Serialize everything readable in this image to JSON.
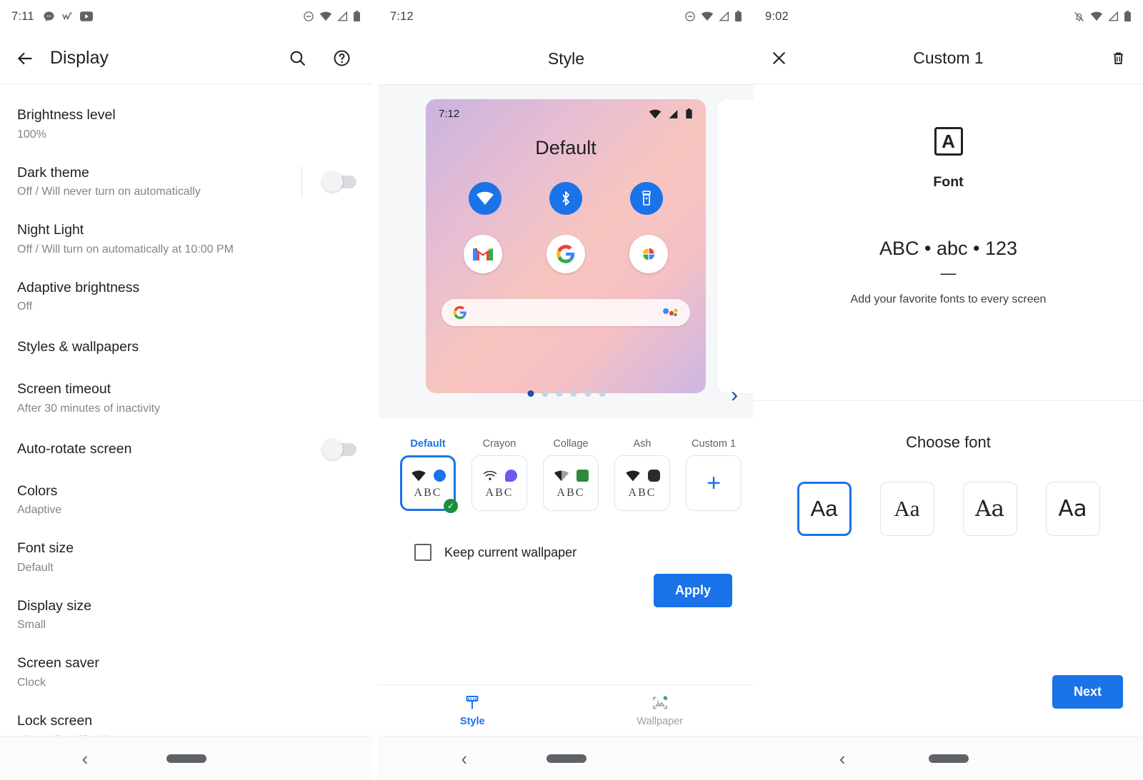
{
  "panel_display": {
    "statusbar": {
      "time": "7:11",
      "notif_icons": [
        "chat-icon",
        "wish-icon",
        "youtube-icon"
      ],
      "right_icons": [
        "dnd-icon",
        "wifi-icon",
        "cellular-icon",
        "battery-icon"
      ]
    },
    "appbar": {
      "title": "Display",
      "back_icon": "arrow-back-icon",
      "search_icon": "search-icon",
      "help_icon": "help-icon"
    },
    "items": [
      {
        "title": "Brightness level",
        "sub": "100%",
        "toggle": null
      },
      {
        "title": "Dark theme",
        "sub": "Off / Will never turn on automatically",
        "toggle": "off"
      },
      {
        "title": "Night Light",
        "sub": "Off / Will turn on automatically at 10:00 PM",
        "toggle": null
      },
      {
        "title": "Adaptive brightness",
        "sub": "Off",
        "toggle": null
      },
      {
        "title": "Styles & wallpapers",
        "sub": "",
        "toggle": null
      },
      {
        "title": "Screen timeout",
        "sub": "After 30 minutes of inactivity",
        "toggle": null
      },
      {
        "title": "Auto-rotate screen",
        "sub": "",
        "toggle": "off"
      },
      {
        "title": "Colors",
        "sub": "Adaptive",
        "toggle": null
      },
      {
        "title": "Font size",
        "sub": "Default",
        "toggle": null
      },
      {
        "title": "Display size",
        "sub": "Small",
        "toggle": null
      },
      {
        "title": "Screen saver",
        "sub": "Clock",
        "toggle": null
      },
      {
        "title": "Lock screen",
        "sub": "Show all notification content",
        "toggle": null
      }
    ],
    "navbar": {
      "back_icon": "nav-back-icon",
      "home_pill": "nav-home-pill"
    }
  },
  "panel_style": {
    "statusbar": {
      "time": "7:12",
      "right_icons": [
        "dnd-icon",
        "wifi-icon",
        "cellular-icon",
        "battery-icon"
      ]
    },
    "appbar": {
      "title": "Style"
    },
    "preview": {
      "time": "7:12",
      "label": "Default",
      "quick_tiles": [
        "wifi-icon",
        "bluetooth-icon",
        "flashlight-icon"
      ],
      "apps": [
        "gmail-icon",
        "google-icon",
        "photos-icon"
      ],
      "search_icon": "google-g-icon",
      "assistant_icon": "assistant-icon"
    },
    "carousel": {
      "dot_count": 6,
      "active_dot": 1,
      "next_icon": "chevron-right-icon"
    },
    "chips": [
      {
        "label": "Default",
        "selected": true,
        "wifi": "wifi-solid-icon",
        "swatch": "#1a73e8",
        "swatch_shape": "circle",
        "abc": "ABC",
        "abc_style": "serif"
      },
      {
        "label": "Crayon",
        "selected": false,
        "wifi": "wifi-line-icon",
        "swatch": "#6a5cf0",
        "swatch_shape": "blob",
        "abc": "ABC",
        "abc_style": "serif"
      },
      {
        "label": "Collage",
        "selected": false,
        "wifi": "wifi-gray-icon",
        "swatch": "#2e8b3d",
        "swatch_shape": "square",
        "abc": "ABC",
        "abc_style": "serif"
      },
      {
        "label": "Ash",
        "selected": false,
        "wifi": "wifi-solid-icon",
        "swatch": "#2b2b2b",
        "swatch_shape": "squircle",
        "abc": "ABC",
        "abc_style": "serif"
      },
      {
        "label": "Custom 1",
        "selected": false,
        "add": true,
        "plus_icon": "plus-icon"
      }
    ],
    "keep_wallpaper": {
      "label": "Keep current wallpaper",
      "checked": false
    },
    "apply_label": "Apply",
    "tabs": [
      {
        "label": "Style",
        "icon": "brush-icon",
        "active": true
      },
      {
        "label": "Wallpaper",
        "icon": "wallpaper-icon",
        "active": false
      }
    ],
    "navbar": {
      "back_icon": "nav-back-icon",
      "home_pill": "nav-home-pill"
    }
  },
  "panel_custom": {
    "statusbar": {
      "time": "9:02",
      "right_icons": [
        "notifications-off-icon",
        "wifi-icon",
        "cellular-icon",
        "battery-icon"
      ]
    },
    "appbar": {
      "title": "Custom 1",
      "close_icon": "close-icon",
      "delete_icon": "trash-icon"
    },
    "hero": {
      "badge_letter": "A",
      "section_name": "Font",
      "sample": "ABC • abc • 123",
      "dash": "—",
      "description": "Add your favorite fonts to every screen"
    },
    "choose_title": "Choose font",
    "font_options": [
      {
        "sample": "Aa",
        "selected": true
      },
      {
        "sample": "Aa",
        "selected": false
      },
      {
        "sample": "Aa",
        "selected": false
      },
      {
        "sample": "Aa",
        "selected": false
      }
    ],
    "next_label": "Next",
    "navbar": {
      "back_icon": "nav-back-icon",
      "home_pill": "nav-home-pill"
    }
  },
  "colors": {
    "accent": "#1a73e8",
    "check_green": "#1e8e3e",
    "text_primary": "#202124",
    "text_secondary": "#80868b"
  }
}
